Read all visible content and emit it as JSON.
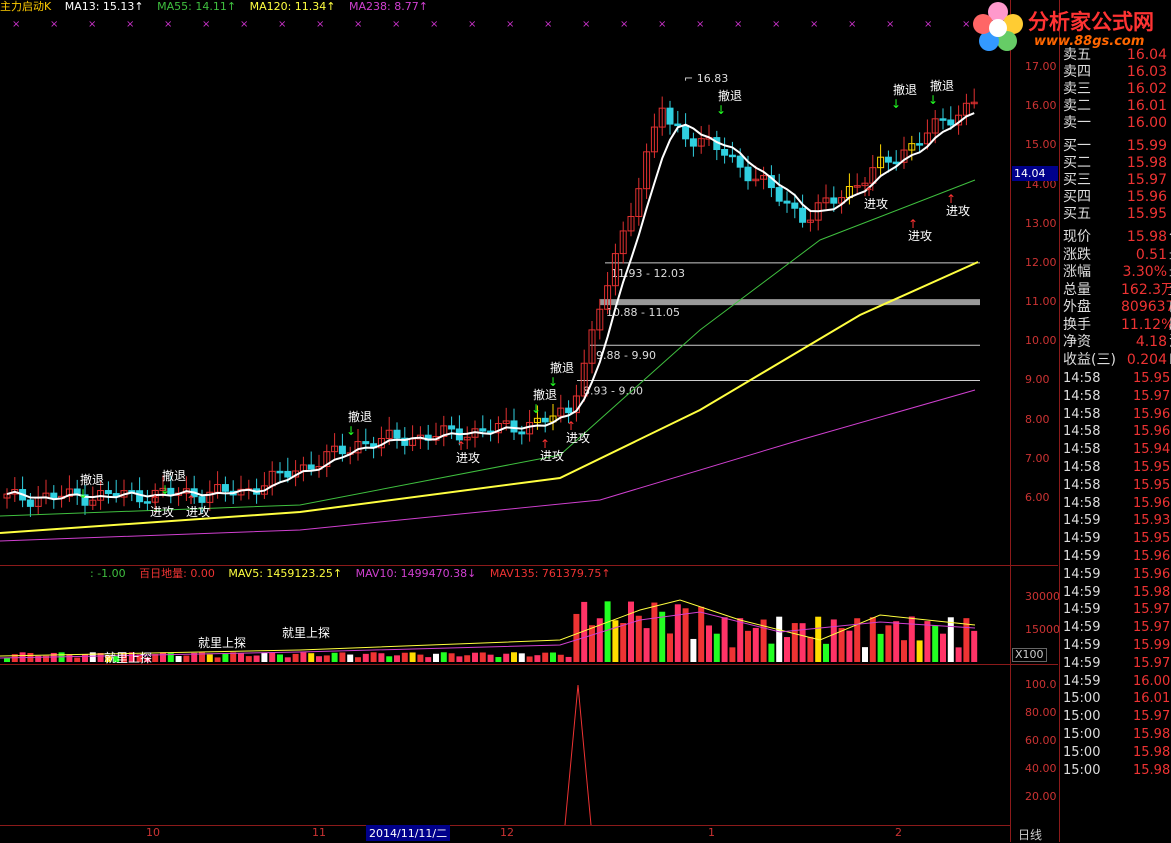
{
  "header": {
    "title": "主力启动K",
    "ma13": "MA13: 15.13↑",
    "ma55": "MA55: 14.11↑",
    "ma120": "MA120: 11.34↑",
    "ma238": "MA238: 8.77↑"
  },
  "logo": {
    "name": "分析家公式网",
    "url": "www.88gs.com"
  },
  "colors": {
    "ma13": "#ffffff",
    "ma55": "#3fbf3f",
    "ma120": "#ffff40",
    "ma238": "#d040d0",
    "up": "#e03030",
    "down": "#30d0e0",
    "grid": "#8b1a1a"
  },
  "price_axis": [
    "17.00",
    "16.00",
    "15.00",
    "14.00",
    "13.00",
    "12.00",
    "11.00",
    "10.00",
    "9.00",
    "8.00",
    "7.00",
    "6.00"
  ],
  "current_price_tag": "14.04",
  "peak_label": "16.83",
  "zones": [
    "11.93 - 12.03",
    "10.88 - 11.05",
    "9.88 - 9.90",
    "8.93 - 9.00"
  ],
  "signals": {
    "retreat": "撤退",
    "attack": "进攻",
    "volume_probe": "就里上探"
  },
  "volume_header": {
    "v0": ": -1.00",
    "v1": "百日地量: 0.00",
    "v2": "MAV5: 1459123.25↑",
    "v3": "MAV10: 1499470.38↓",
    "v4": "MAV135: 761379.75↑"
  },
  "volume_axis": [
    "30000",
    "15000"
  ],
  "volume_unit": "X100",
  "osc_axis": [
    "100.0",
    "80.00",
    "60.00",
    "40.00",
    "20.00"
  ],
  "date_axis": [
    "10",
    "11",
    "12",
    "1",
    "2"
  ],
  "date_cursor": "2014/11/11/二",
  "period": "日线",
  "orderbook": [
    {
      "label": "卖五",
      "value": "16.04"
    },
    {
      "label": "卖四",
      "value": "16.03"
    },
    {
      "label": "卖三",
      "value": "16.02"
    },
    {
      "label": "卖二",
      "value": "16.01"
    },
    {
      "label": "卖一",
      "value": "16.00"
    },
    {
      "label": "买一",
      "value": "15.99"
    },
    {
      "label": "买二",
      "value": "15.98"
    },
    {
      "label": "买三",
      "value": "15.97"
    },
    {
      "label": "买四",
      "value": "15.96"
    },
    {
      "label": "买五",
      "value": "15.95"
    }
  ],
  "quote": [
    {
      "label": "现价",
      "value": "15.98",
      "extra": "今"
    },
    {
      "label": "涨跌",
      "value": "0.51",
      "extra": "最"
    },
    {
      "label": "涨幅",
      "value": "3.30%",
      "extra": "最"
    },
    {
      "label": "总量",
      "value": "162.3万",
      "extra": "量"
    },
    {
      "label": "外盘",
      "value": "809637",
      "extra": "内"
    },
    {
      "label": "换手",
      "value": "11.12%",
      "extra": "股"
    },
    {
      "label": "净资",
      "value": "4.18",
      "extra": "流"
    },
    {
      "label": "收益(三)",
      "value": "0.204",
      "extra": "PE"
    }
  ],
  "ticks": [
    {
      "t": "14:58",
      "p": "15.95"
    },
    {
      "t": "14:58",
      "p": "15.97"
    },
    {
      "t": "14:58",
      "p": "15.96"
    },
    {
      "t": "14:58",
      "p": "15.96"
    },
    {
      "t": "14:58",
      "p": "15.94"
    },
    {
      "t": "14:58",
      "p": "15.95"
    },
    {
      "t": "14:58",
      "p": "15.95"
    },
    {
      "t": "14:58",
      "p": "15.96"
    },
    {
      "t": "14:59",
      "p": "15.93"
    },
    {
      "t": "14:59",
      "p": "15.95"
    },
    {
      "t": "14:59",
      "p": "15.96"
    },
    {
      "t": "14:59",
      "p": "15.96"
    },
    {
      "t": "14:59",
      "p": "15.98"
    },
    {
      "t": "14:59",
      "p": "15.97"
    },
    {
      "t": "14:59",
      "p": "15.97"
    },
    {
      "t": "14:59",
      "p": "15.99"
    },
    {
      "t": "14:59",
      "p": "15.97"
    },
    {
      "t": "14:59",
      "p": "16.00"
    },
    {
      "t": "15:00",
      "p": "16.01"
    },
    {
      "t": "15:00",
      "p": "15.97"
    },
    {
      "t": "15:00",
      "p": "15.98"
    },
    {
      "t": "15:00",
      "p": "15.98"
    },
    {
      "t": "15:00",
      "p": "15.98"
    }
  ]
}
